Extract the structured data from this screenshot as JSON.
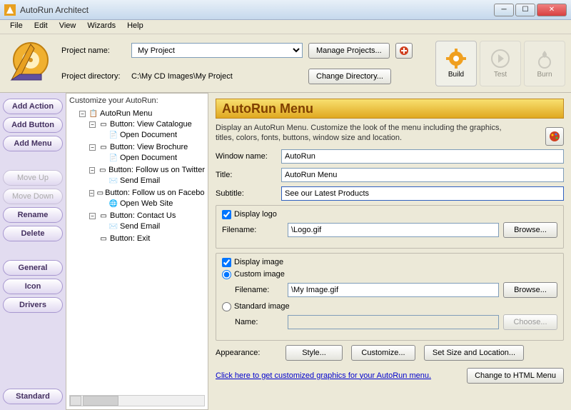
{
  "window": {
    "title": "AutoRun Architect"
  },
  "menu": {
    "file": "File",
    "edit": "Edit",
    "view": "View",
    "wizards": "Wizards",
    "help": "Help"
  },
  "top": {
    "projectname_label": "Project name:",
    "projectname_value": "My Project",
    "projectdir_label": "Project directory:",
    "projectdir_value": "C:\\My CD Images\\My Project",
    "manage_projects": "Manage Projects...",
    "change_directory": "Change Directory...",
    "build": "Build",
    "test": "Test",
    "burn": "Burn"
  },
  "sidebar": {
    "add_action": "Add Action",
    "add_button": "Add Button",
    "add_menu": "Add Menu",
    "move_up": "Move Up",
    "move_down": "Move Down",
    "rename": "Rename",
    "delete": "Delete",
    "general": "General",
    "icon": "Icon",
    "drivers": "Drivers",
    "standard": "Standard"
  },
  "tree": {
    "label": "Customize your AutoRun:",
    "root": "AutoRun Menu",
    "items": [
      {
        "label": "Button: View Catalogue",
        "children": [
          {
            "label": "Open Document",
            "kind": "doc"
          }
        ]
      },
      {
        "label": "Button: View Brochure",
        "children": [
          {
            "label": "Open Document",
            "kind": "doc"
          }
        ]
      },
      {
        "label": "Button: Follow us on Twitter",
        "children": [
          {
            "label": "Send Email",
            "kind": "mail"
          }
        ]
      },
      {
        "label": "Button: Follow us on Facebook",
        "children": [
          {
            "label": "Open Web Site",
            "kind": "web"
          }
        ]
      },
      {
        "label": "Button: Contact Us",
        "children": [
          {
            "label": "Send Email",
            "kind": "mail"
          }
        ]
      },
      {
        "label": "Button: Exit",
        "children": []
      }
    ]
  },
  "detail": {
    "header": "AutoRun Menu",
    "description": "Display an AutoRun Menu. Customize the look of the menu including the graphics, titles, colors, fonts, buttons, window size and location.",
    "windowname_label": "Window name:",
    "windowname_value": "AutoRun",
    "title_label": "Title:",
    "title_value": "AutoRun Menu",
    "subtitle_label": "Subtitle:",
    "subtitle_value": "See our Latest Products",
    "display_logo": "Display logo",
    "filename_label": "Filename:",
    "logo_filename": "\\Logo.gif",
    "browse": "Browse...",
    "display_image": "Display image",
    "custom_image": "Custom image",
    "custom_filename": "\\My Image.gif",
    "standard_image": "Standard image",
    "name_label": "Name:",
    "choose": "Choose...",
    "appearance_label": "Appearance:",
    "style": "Style...",
    "customize": "Customize...",
    "setsize": "Set Size and Location...",
    "link": "Click here to get customized graphics for your AutoRun menu.",
    "change_html": "Change to HTML Menu"
  }
}
